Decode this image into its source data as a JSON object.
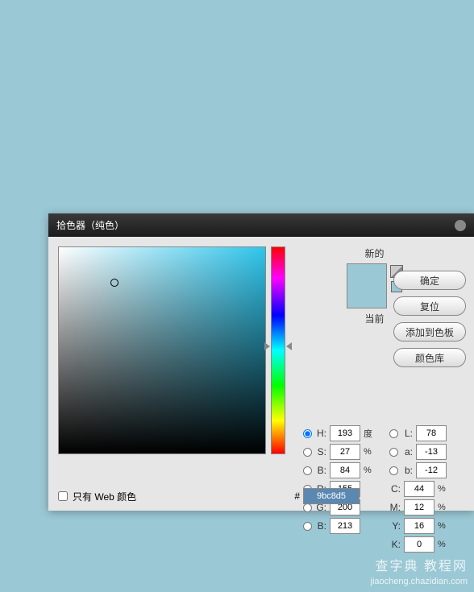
{
  "dialog": {
    "title": "拾色器（纯色）",
    "new_label": "新的",
    "current_label": "当前",
    "swatch_new_color": "#9bc8d5",
    "swatch_current_color": "#9bc8d5",
    "buttons": {
      "ok": "确定",
      "reset": "复位",
      "add_swatch": "添加到色板",
      "color_lib": "颜色库"
    },
    "radios_selected": "H",
    "hsb": {
      "H": {
        "label": "H:",
        "value": "193",
        "unit": "度"
      },
      "S": {
        "label": "S:",
        "value": "27",
        "unit": "%"
      },
      "B": {
        "label": "B:",
        "value": "84",
        "unit": "%"
      }
    },
    "lab": {
      "L": {
        "label": "L:",
        "value": "78"
      },
      "a": {
        "label": "a:",
        "value": "-13"
      },
      "b": {
        "label": "b:",
        "value": "-12"
      }
    },
    "rgb": {
      "R": {
        "label": "R:",
        "value": "155"
      },
      "G": {
        "label": "G:",
        "value": "200"
      },
      "B": {
        "label": "B:",
        "value": "213"
      }
    },
    "cmyk": {
      "C": {
        "label": "C:",
        "value": "44",
        "unit": "%"
      },
      "M": {
        "label": "M:",
        "value": "12",
        "unit": "%"
      },
      "Y": {
        "label": "Y:",
        "value": "16",
        "unit": "%"
      },
      "K": {
        "label": "K:",
        "value": "0",
        "unit": "%"
      }
    },
    "hex": {
      "label": "#",
      "value": "9bc8d5"
    },
    "web_only": {
      "label": "只有 Web 颜色"
    }
  },
  "watermark": {
    "line1": "查字典 教程网",
    "line2": "jiaocheng.chazidian.com"
  }
}
